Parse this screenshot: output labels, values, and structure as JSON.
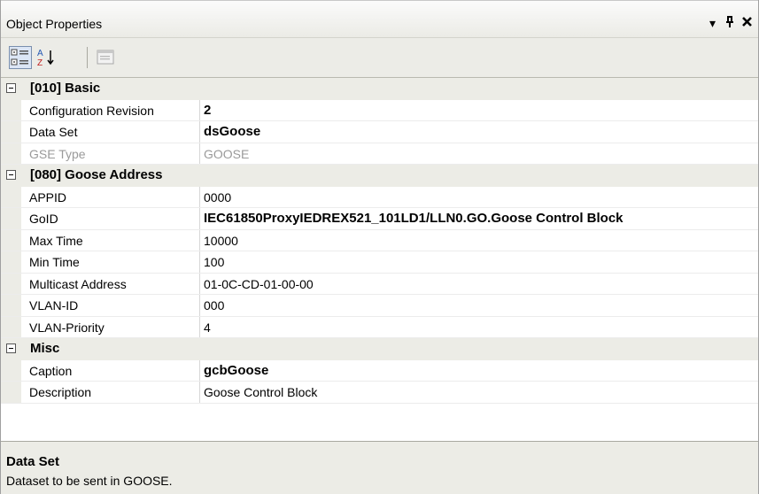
{
  "window": {
    "title": "Object Properties",
    "controls": {
      "dropdown": "▾",
      "pin": "ꟼ",
      "close": "✕"
    }
  },
  "toolbar": {
    "buttons": [
      {
        "name": "categorized-button",
        "icon": "categorized-icon",
        "active": true
      },
      {
        "name": "alphabetical-button",
        "icon": "sort-az-icon",
        "active": false
      },
      {
        "name": "property-pages-button",
        "icon": "property-pages-icon",
        "active": false,
        "disabled": true
      }
    ]
  },
  "grid": {
    "categories": [
      {
        "label": "[010] Basic",
        "rows": [
          {
            "name": "Configuration Revision",
            "value": "2",
            "bold": true
          },
          {
            "name": "Data Set",
            "value": "dsGoose",
            "bold": true
          },
          {
            "name": "GSE Type",
            "value": "GOOSE",
            "disabled": true
          }
        ]
      },
      {
        "label": "[080] Goose Address",
        "rows": [
          {
            "name": "APPID",
            "value": "0000"
          },
          {
            "name": "GoID",
            "value": "IEC61850ProxyIEDREX521_101LD1/LLN0.GO.Goose Control Block",
            "bold": true
          },
          {
            "name": "Max Time",
            "value": "10000"
          },
          {
            "name": "Min Time",
            "value": "100"
          },
          {
            "name": "Multicast Address",
            "value": "01-0C-CD-01-00-00"
          },
          {
            "name": "VLAN-ID",
            "value": "000"
          },
          {
            "name": "VLAN-Priority",
            "value": "4"
          }
        ]
      },
      {
        "label": "Misc",
        "rows": [
          {
            "name": "Caption",
            "value": "gcbGoose",
            "bold": true
          },
          {
            "name": "Description",
            "value": "Goose Control Block"
          }
        ]
      }
    ]
  },
  "description": {
    "title": "Data Set",
    "text": "Dataset to be sent in GOOSE."
  },
  "colors": {
    "panel_background": "#ecece6",
    "grid_line": "#ececec",
    "disabled_text": "#9a9a9a"
  }
}
